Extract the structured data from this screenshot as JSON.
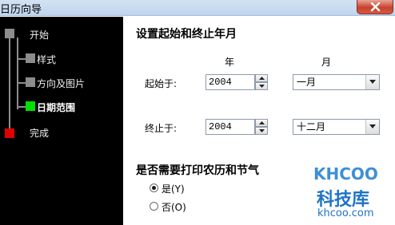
{
  "window": {
    "title": "日历向导"
  },
  "tree": {
    "items": [
      {
        "label": "开始",
        "color": "#8c8c8c"
      },
      {
        "label": "样式",
        "color": "#8c8c8c"
      },
      {
        "label": "方向及图片",
        "color": "#8c8c8c"
      },
      {
        "label": "日期范围",
        "color": "#00e000",
        "active": true
      },
      {
        "label": "完成",
        "color": "#e00000"
      }
    ]
  },
  "date_section": {
    "title": "设置起始和终止年月",
    "col_year": "年",
    "col_month": "月",
    "start": {
      "label": "起始于:",
      "year": "2004",
      "month": "一月"
    },
    "end": {
      "label": "终止于:",
      "year": "2004",
      "month": "十二月"
    }
  },
  "lunar_section": {
    "title": "是否需要打印农历和节气",
    "options": [
      {
        "label": "是(Y)",
        "checked": true
      },
      {
        "label": "否(O)",
        "checked": false
      }
    ]
  },
  "watermark": {
    "logo": "KHCOO",
    "name": "科技库",
    "url": "khcoo.com"
  }
}
